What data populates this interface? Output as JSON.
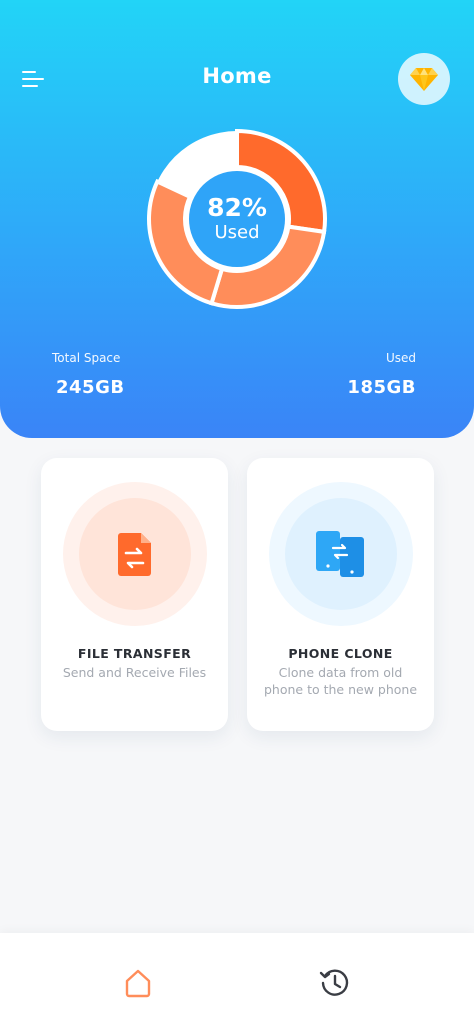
{
  "header": {
    "title": "Home",
    "menu_icon": "menu-icon",
    "premium_icon": "diamond-icon"
  },
  "storage": {
    "percent_label": "82%",
    "percent_value": 82,
    "used_caption": "Used",
    "total_label": "Total Space",
    "total_value": "245GB",
    "used_label": "Used",
    "used_value": "185GB"
  },
  "cards": [
    {
      "title": "FILE TRANSFER",
      "description": "Send and Receive Files",
      "icon": "file-transfer-icon"
    },
    {
      "title": "PHONE CLONE",
      "description": "Clone data from old phone to the new phone",
      "icon": "phone-clone-icon"
    }
  ],
  "bottom_nav": {
    "items": [
      {
        "icon": "home-icon",
        "active": true
      },
      {
        "icon": "history-icon",
        "active": false
      }
    ]
  },
  "colors": {
    "header_top": "#22d4f7",
    "header_bottom": "#3a84f7",
    "accent_orange": "#ff6a2c",
    "accent_orange_light": "#ff8d5a",
    "accent_blue": "#2ea7f6",
    "premium_gold": "#ffb400"
  }
}
